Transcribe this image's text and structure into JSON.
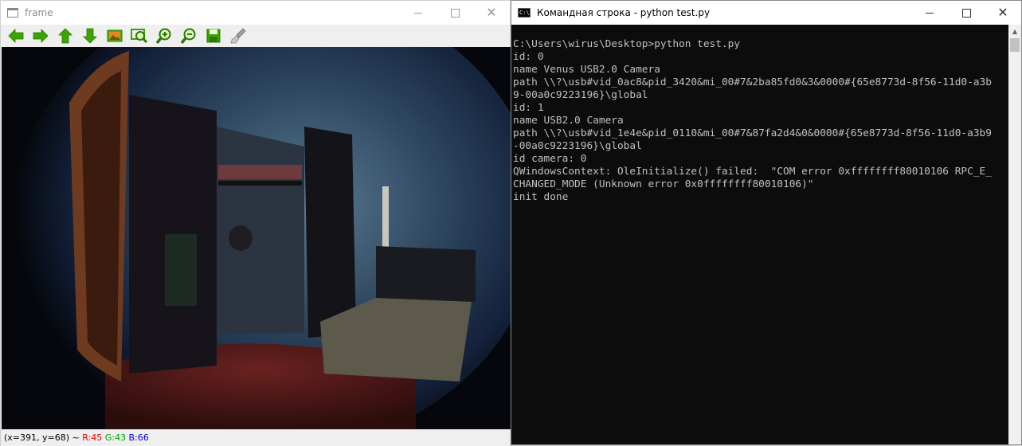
{
  "frame_window": {
    "title": "frame",
    "buttons": {
      "minimize": "minimize",
      "maximize": "maximize",
      "close": "✕"
    },
    "toolbar": [
      {
        "name": "pan-left-button",
        "icon": "arrow-left-icon",
        "color": "#3aa500"
      },
      {
        "name": "pan-right-button",
        "icon": "arrow-right-icon",
        "color": "#3aa500"
      },
      {
        "name": "pan-up-button",
        "icon": "arrow-up-icon",
        "color": "#3aa500"
      },
      {
        "name": "pan-down-button",
        "icon": "arrow-down-icon",
        "color": "#3aa500"
      },
      {
        "name": "zoom-x1-button",
        "icon": "image-icon",
        "color": "#3aa500"
      },
      {
        "name": "zoom-fit-button",
        "icon": "zoom-fit-icon",
        "color": "#3aa500"
      },
      {
        "name": "zoom-in-button",
        "icon": "zoom-in-icon",
        "color": "#3aa500"
      },
      {
        "name": "zoom-out-button",
        "icon": "zoom-out-icon",
        "color": "#3aa500"
      },
      {
        "name": "save-button",
        "icon": "floppy-disk-icon",
        "color": "#3aa500"
      },
      {
        "name": "properties-button",
        "icon": "brush-icon",
        "color": "#9a9a9a"
      }
    ],
    "status": {
      "coords": "(x=391, y=68) ~ ",
      "r": "R:45",
      "g": "G:43",
      "b": "B:66"
    }
  },
  "console_window": {
    "title": "Командная строка - python  test.py",
    "icon_text": "C:\\",
    "buttons": {
      "minimize": "minimize",
      "maximize": "maximize",
      "close": "✕"
    },
    "lines": [
      "C:\\Users\\wirus\\Desktop>python test.py",
      "id: 0",
      "name Venus USB2.0 Camera",
      "path \\\\?\\usb#vid_0ac8&pid_3420&mi_00#7&2ba85fd0&3&0000#{65e8773d-8f56-11d0-a3b",
      "9-00a0c9223196}\\global",
      "id: 1",
      "name USB2.0 Camera",
      "path \\\\?\\usb#vid_1e4e&pid_0110&mi_00#7&87fa2d4&0&0000#{65e8773d-8f56-11d0-a3b9",
      "-00a0c9223196}\\global",
      "id camera: 0",
      "QWindowsContext: OleInitialize() failed:  \"COM error 0xffffffff80010106 RPC_E_",
      "CHANGED_MODE (Unknown error 0x0ffffffff80010106)\"",
      "init done"
    ]
  }
}
